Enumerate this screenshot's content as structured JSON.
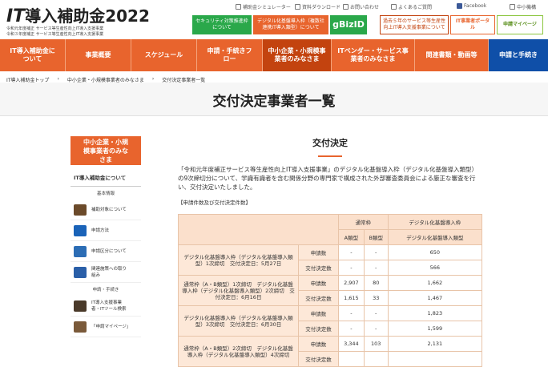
{
  "brand": {
    "logo_prefix": "IT",
    "logo_text": "導入補助金2022",
    "sub1": "令和元年度補正 サービス等生産性向上IT導入支援事業",
    "sub2": "令和３年度補正 サービス等生産性向上IT導入支援事業"
  },
  "utility": [
    "補助金シミュレーター",
    "資料ダウンロード",
    "お問い合わせ",
    "よくあるご質問",
    "Facebook",
    "中小機構"
  ],
  "banners": [
    {
      "label": "セキュリティ対策推進枠について",
      "color": "#2aa84a"
    },
    {
      "label": "デジタル化基盤導入枠（複数社連携IT導入類型）について",
      "color": "#e8642d"
    },
    {
      "label": "gBizID",
      "color": "#2aa84a"
    },
    {
      "label": "過去５年のサービス等生産性向上IT導入支援事業について",
      "color": "#ffffff"
    },
    {
      "label": "IT事業者ポータル",
      "color": "#e8642d"
    },
    {
      "label": "申請マイページ",
      "color": "#8cc63f"
    }
  ],
  "nav": [
    "IT導入補助金について",
    "事業概要",
    "スケジュール",
    "申請・手続きフロー",
    "中小企業・小規模事業者のみなさま",
    "ITベンダー・サービス事業者のみなさま",
    "関連書類・動画等",
    "申請と手続き"
  ],
  "breadcrumb": [
    "IT導入補助金トップ",
    "中小企業・小規模事業者のみなさま",
    "交付決定事業者一覧"
  ],
  "page_title": "交付決定事業者一覧",
  "sidebar": {
    "header": "中小企業・小規模事業者のみなさま",
    "section1": "IT導入補助金について",
    "cat1": "基本情報",
    "items": [
      "補助対象について",
      "申請方法",
      "申請区分について",
      "関連施策への取り組み"
    ],
    "cat2": "申請・手続き",
    "items2": [
      "IT導入支援事業者・ITツール検索",
      "「申請マイページ」"
    ]
  },
  "main": {
    "heading": "交付決定",
    "paragraph": "「令和元年度補正サービス等生産性向上IT導入支援事業」のデジタル化基盤導入枠（デジタル化基盤導入類型）の9次締切分について、学識有識者を含む関係分野の専門家で構成された外部審査委員会による厳正な審査を行い、交付決定いたしました。",
    "table_caption": "【申請件数及び交付決定件数】"
  },
  "table": {
    "header_groups": [
      "通常枠",
      "デジタル化基盤導入枠"
    ],
    "header_sub": [
      "A類型",
      "B類型",
      "デジタル化基盤導入類型"
    ],
    "rows": [
      {
        "label": "デジタル化基盤導入枠（デジタル化基盤導入類型）1次締切　交付決定日：5月27日",
        "a": [
          "申請数",
          "-",
          "-",
          "650"
        ],
        "b": [
          "交付決定数",
          "-",
          "-",
          "566"
        ]
      },
      {
        "label": "通常枠（A・B類型）1次締切　デジタル化基盤導入枠（デジタル化基盤導入類型）2次締切　交付決定日：6月16日",
        "a": [
          "申請数",
          "2,907",
          "80",
          "1,662"
        ],
        "b": [
          "交付決定数",
          "1,615",
          "33",
          "1,467"
        ]
      },
      {
        "label": "デジタル化基盤導入枠（デジタル化基盤導入類型）3次締切　交付決定日：6月30日",
        "a": [
          "申請数",
          "-",
          "-",
          "1,823"
        ],
        "b": [
          "交付決定数",
          "-",
          "-",
          "1,599"
        ]
      },
      {
        "label": "通常枠（A・B類型）2次締切　デジタル化基盤導入枠（デジタル化基盤導入類型）4次締切",
        "a": [
          "申請数",
          "3,344",
          "103",
          "2,131"
        ],
        "b": [
          "交付決定数",
          "",
          "",
          ""
        ]
      }
    ]
  }
}
